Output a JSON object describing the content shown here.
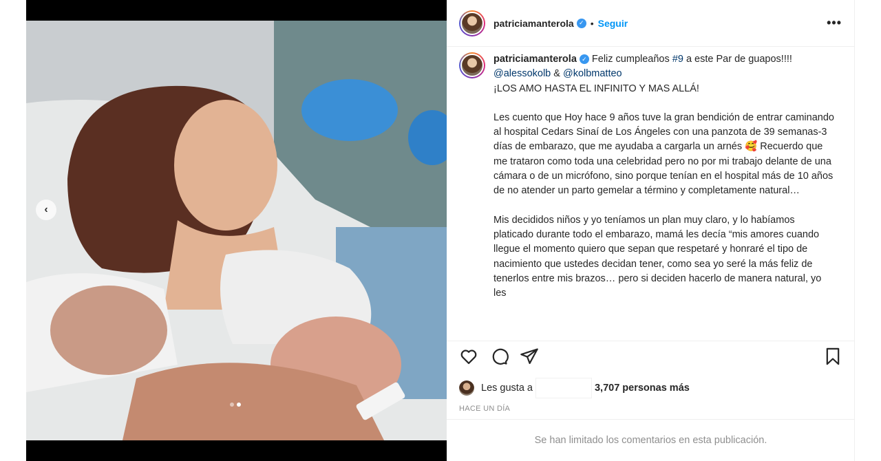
{
  "post": {
    "username": "patriciamanterola",
    "follow_label": "Seguir",
    "separator": "•",
    "more_label": "•••"
  },
  "caption": {
    "username": "patriciamanterola",
    "line1_text": " Feliz cumpleaños ",
    "hashtag": "#9",
    "line1_rest": " a este Par de guapos!!!! ",
    "mention1": "@alessokolb",
    "amp": " & ",
    "mention2": "@kolbmatteo",
    "line2": "¡LOS AMO HASTA EL INFINITO Y MAS ALLÁ!",
    "p1": "Les cuento que Hoy hace 9 años tuve la gran bendición de entrar caminando al hospital Cedars Sinaí de Los Ángeles con una panzota de 39 semanas-3 días de embarazo, que me ayudaba a cargarla un arnés 🥰 Recuerdo que me trataron como toda una celebridad pero no por mi trabajo delante de una cámara o de un micrófono, sino porque tenían en el hospital más de 10 años de no atender un parto gemelar a término y completamente natural…",
    "p2": "Mis decididos niños y yo teníamos un plan muy claro, y lo habíamos platicado durante todo el embarazo, mamá les decía “mis amores cuando llegue el momento quiero que sepan que respetaré y honraré el tipo de nacimiento que ustedes decidan tener, como sea yo seré la más feliz de tenerlos entre mis brazos… pero si deciden hacerlo de manera natural, yo les"
  },
  "likes": {
    "prefix": "Les gusta a",
    "count_text": "3,707 personas más"
  },
  "time_label": "HACE UN DÍA",
  "comments_limited": "Se han limitado los comentarios en esta publicación.",
  "carousel": {
    "prev_icon": "chevron-left-icon",
    "slide_count": 2,
    "active_slide": 2
  },
  "icons": {
    "like": "heart-icon",
    "comment": "comment-icon",
    "share": "share-icon",
    "save": "bookmark-icon"
  },
  "colors": {
    "link": "#0095f6",
    "verified": "#3897f0",
    "muted": "#8e8e8e"
  }
}
